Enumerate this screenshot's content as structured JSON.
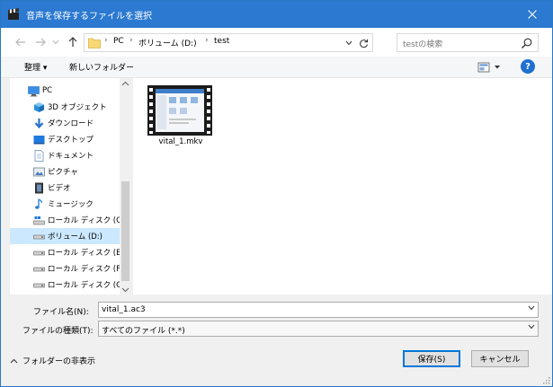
{
  "window": {
    "title": "音声を保存するファイルを選択",
    "accent": "#2b79d0"
  },
  "address": {
    "breadcrumbs": [
      "PC",
      "ボリューム (D:)",
      "test"
    ],
    "separator": "›"
  },
  "search": {
    "placeholder": "testの検索"
  },
  "toolbar": {
    "organize_label": "整理 ▾",
    "new_folder_label": "新しいフォルダー"
  },
  "navigation": {
    "items": [
      {
        "label": "PC",
        "icon": "pc-icon"
      },
      {
        "label": "3D オブジェクト",
        "icon": "3d-objects-icon"
      },
      {
        "label": "ダウンロード",
        "icon": "download-icon"
      },
      {
        "label": "デスクトップ",
        "icon": "desktop-icon"
      },
      {
        "label": "ドキュメント",
        "icon": "document-icon"
      },
      {
        "label": "ピクチャ",
        "icon": "pictures-icon"
      },
      {
        "label": "ビデオ",
        "icon": "video-icon"
      },
      {
        "label": "ミュージック",
        "icon": "music-icon"
      },
      {
        "label": "ローカル ディスク (C:)",
        "icon": "drive-c-icon"
      },
      {
        "label": "ボリューム (D:)",
        "icon": "drive-icon",
        "selected": true
      },
      {
        "label": "ローカル ディスク (E:)",
        "icon": "drive-icon"
      },
      {
        "label": "ローカル ディスク (F:)",
        "icon": "drive-icon"
      },
      {
        "label": "ローカル ディスク (G:)",
        "icon": "drive-icon"
      }
    ]
  },
  "files": [
    {
      "name": "vital_1.mkv",
      "icon": "video-file-icon"
    }
  ],
  "filename": {
    "label": "ファイル名(N):",
    "value": "vital_1.ac3"
  },
  "filetype": {
    "label": "ファイルの種類(T):",
    "value": "すべてのファイル (*.*)"
  },
  "footer": {
    "hide_folders_label": "フォルダーの非表示",
    "save_label": "保存(S)",
    "cancel_label": "キャンセル"
  }
}
